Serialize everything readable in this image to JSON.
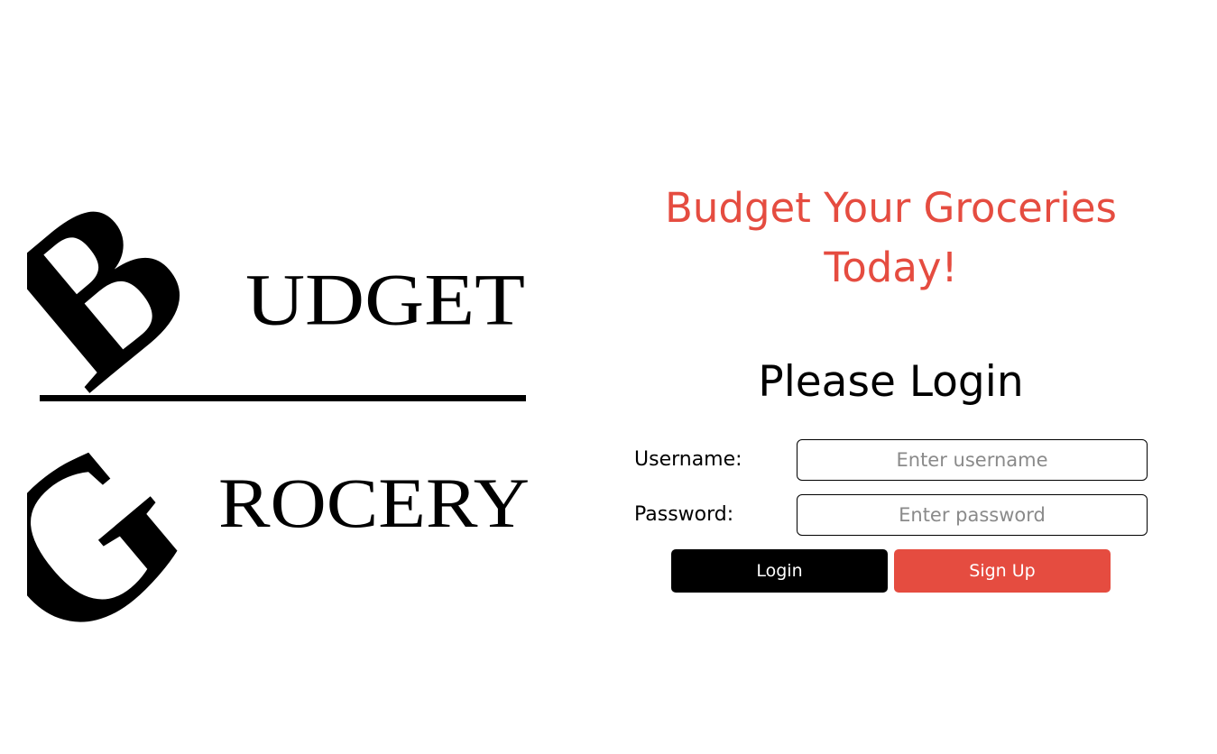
{
  "logo": {
    "word1_initial": "B",
    "word1_rest": "UDGET",
    "word2_initial": "G",
    "word2_rest": "ROCERY"
  },
  "tagline": {
    "line1": "Budget Your Groceries",
    "line2": "Today!"
  },
  "login": {
    "heading": "Please Login",
    "username_label": "Username:",
    "username_placeholder": "Enter username",
    "username_value": "",
    "password_label": "Password:",
    "password_placeholder": "Enter password",
    "password_value": "",
    "login_button": "Login",
    "signup_button": "Sign Up"
  },
  "colors": {
    "accent": "#e54c40",
    "primary_button": "#000000",
    "text": "#000000",
    "background": "#ffffff"
  }
}
